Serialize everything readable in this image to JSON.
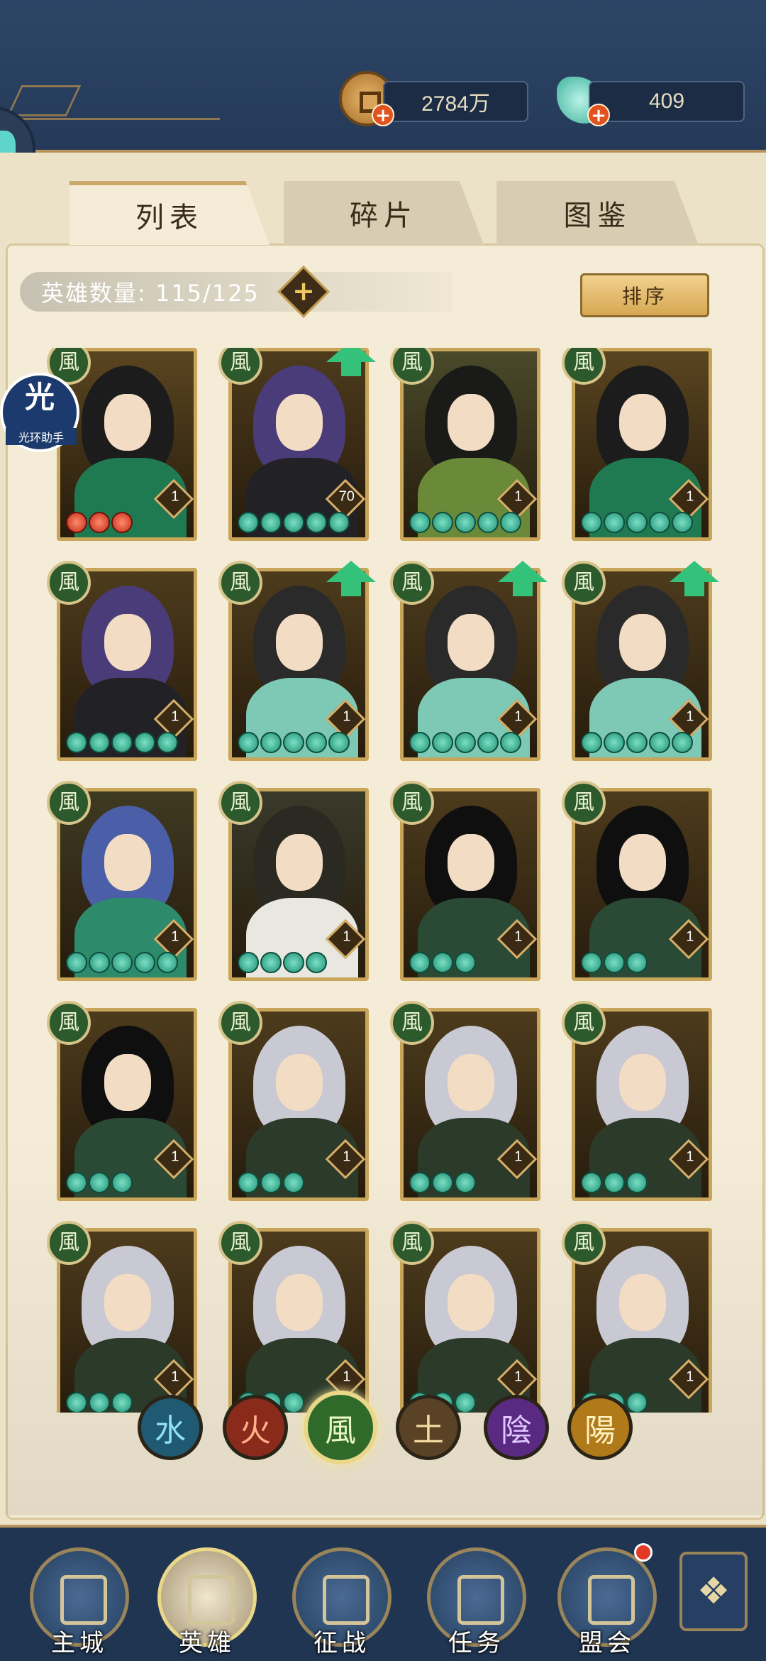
{
  "header": {
    "coins": {
      "value": "2784万",
      "icon": "coin-icon"
    },
    "jade": {
      "value": "409",
      "icon": "jade-icon"
    },
    "plus": "+"
  },
  "tabs": [
    {
      "label": "列表",
      "active": true
    },
    {
      "label": "碎片",
      "active": false
    },
    {
      "label": "图鉴",
      "active": false
    }
  ],
  "hero_count": {
    "label": "英雄数量: 115/125",
    "plus": "+"
  },
  "sort_label": "排序",
  "helper": {
    "big": "光",
    "small": "光环助手"
  },
  "element_glyph": "風",
  "heroes": [
    {
      "level": "1",
      "stars": 3,
      "star_color": "red",
      "upgrade": false,
      "style": "green-lady"
    },
    {
      "level": "70",
      "stars": 5,
      "star_color": "green",
      "upgrade": true,
      "style": "purple-girl"
    },
    {
      "level": "1",
      "stars": 5,
      "star_color": "green",
      "upgrade": false,
      "style": "dark-lady"
    },
    {
      "level": "1",
      "stars": 5,
      "star_color": "green",
      "upgrade": false,
      "style": "green-lady"
    },
    {
      "level": "1",
      "stars": 5,
      "star_color": "green",
      "upgrade": false,
      "style": "purple-girl"
    },
    {
      "level": "1",
      "stars": 5,
      "star_color": "green",
      "upgrade": true,
      "style": "masked-man"
    },
    {
      "level": "1",
      "stars": 5,
      "star_color": "green",
      "upgrade": true,
      "style": "masked-man"
    },
    {
      "level": "1",
      "stars": 5,
      "star_color": "green",
      "upgrade": true,
      "style": "masked-man"
    },
    {
      "level": "1",
      "stars": 5,
      "star_color": "green",
      "upgrade": false,
      "style": "scholar"
    },
    {
      "level": "1",
      "stars": 4,
      "star_color": "green",
      "upgrade": false,
      "style": "warrior"
    },
    {
      "level": "1",
      "stars": 3,
      "star_color": "green",
      "upgrade": false,
      "style": "black-hair"
    },
    {
      "level": "1",
      "stars": 3,
      "star_color": "green",
      "upgrade": false,
      "style": "black-hair"
    },
    {
      "level": "1",
      "stars": 3,
      "star_color": "green",
      "upgrade": false,
      "style": "black-hair"
    },
    {
      "level": "1",
      "stars": 3,
      "star_color": "green",
      "upgrade": false,
      "style": "silver-hair"
    },
    {
      "level": "1",
      "stars": 3,
      "star_color": "green",
      "upgrade": false,
      "style": "silver-hair"
    },
    {
      "level": "1",
      "stars": 3,
      "star_color": "green",
      "upgrade": false,
      "style": "silver-hair"
    },
    {
      "level": "1",
      "stars": 3,
      "star_color": "green",
      "upgrade": false,
      "style": "silver-hair"
    },
    {
      "level": "1",
      "stars": 3,
      "star_color": "green",
      "upgrade": false,
      "style": "silver-hair"
    },
    {
      "level": "1",
      "stars": 3,
      "star_color": "green",
      "upgrade": false,
      "style": "silver-hair"
    },
    {
      "level": "1",
      "stars": 3,
      "star_color": "green",
      "upgrade": false,
      "style": "silver-hair"
    }
  ],
  "element_filters": [
    {
      "glyph": "水",
      "color": "#1f5a72",
      "text": "#8fe0f0",
      "selected": false
    },
    {
      "glyph": "火",
      "color": "#8a2a1a",
      "text": "#ffb08a",
      "selected": false
    },
    {
      "glyph": "風",
      "color": "#2f6a2a",
      "text": "#e8f6c6",
      "selected": true
    },
    {
      "glyph": "土",
      "color": "#5a4226",
      "text": "#f4dba0",
      "selected": false
    },
    {
      "glyph": "陰",
      "color": "#5a2a82",
      "text": "#e0c6ff",
      "selected": false
    },
    {
      "glyph": "陽",
      "color": "#b07a1a",
      "text": "#fff0c0",
      "selected": false
    }
  ],
  "bottom_nav": [
    {
      "label": "主城",
      "icon": "city-icon",
      "active": false,
      "dot": false
    },
    {
      "label": "英雄",
      "icon": "hero-icon",
      "active": true,
      "dot": false
    },
    {
      "label": "征战",
      "icon": "battle-icon",
      "active": false,
      "dot": false
    },
    {
      "label": "任务",
      "icon": "task-icon",
      "active": false,
      "dot": false
    },
    {
      "label": "盟会",
      "icon": "alliance-icon",
      "active": false,
      "dot": true
    }
  ],
  "menu_icon": "❖"
}
